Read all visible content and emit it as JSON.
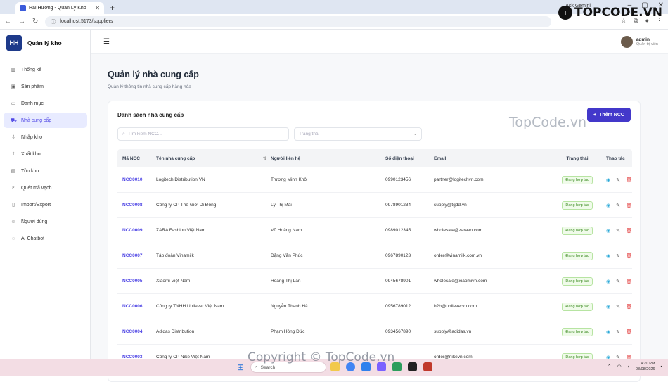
{
  "browser": {
    "tab_title": "Hải Hương - Quản Lý Kho",
    "url": "localhost:5173/suppliers",
    "ask_gemini": "Ask Gemini"
  },
  "sidebar": {
    "brand_name": "Quản lý kho",
    "logo_text": "HH",
    "items": [
      {
        "label": "Thống kê",
        "icon": "chart-icon",
        "active": false
      },
      {
        "label": "Sản phẩm",
        "icon": "box-icon",
        "active": false
      },
      {
        "label": "Danh mục",
        "icon": "folder-icon",
        "active": false
      },
      {
        "label": "Nhà cung cấp",
        "icon": "truck-icon",
        "active": true
      },
      {
        "label": "Nhập kho",
        "icon": "import-icon",
        "active": false
      },
      {
        "label": "Xuất kho",
        "icon": "export-icon",
        "active": false
      },
      {
        "label": "Tồn kho",
        "icon": "inventory-icon",
        "active": false
      },
      {
        "label": "Quét mã vạch",
        "icon": "scan-icon",
        "active": false
      },
      {
        "label": "Import/Export",
        "icon": "file-icon",
        "active": false
      },
      {
        "label": "Người dùng",
        "icon": "user-icon",
        "active": false
      },
      {
        "label": "AI Chatbot",
        "icon": "chat-icon",
        "active": false
      }
    ]
  },
  "topbar": {
    "user_name": "admin",
    "user_role": "Quản trị viên"
  },
  "page": {
    "title": "Quản lý nhà cung cấp",
    "subtitle": "Quản lý thông tin nhà cung cấp hàng hóa"
  },
  "card": {
    "title": "Danh sách nhà cung cấp",
    "add_button": "Thêm NCC",
    "search_placeholder": "Tìm kiếm NCC...",
    "status_placeholder": "Trạng thái"
  },
  "table": {
    "headers": [
      "Mã NCC",
      "Tên nhà cung cấp",
      "Người liên hệ",
      "Số điện thoại",
      "Email",
      "Trạng thái",
      "Thao tác"
    ],
    "rows": [
      {
        "code": "NCC0010",
        "name": "Logitech Distribution VN",
        "contact": "Trương Minh Khôi",
        "phone": "0990123456",
        "email": "partner@logitechvn.com",
        "status": "Đang hợp tác"
      },
      {
        "code": "NCC0008",
        "name": "Công ty CP Thế Giới Di Động",
        "contact": "Lý Thị Mai",
        "phone": "0978901234",
        "email": "supply@tgdd.vn",
        "status": "Đang hợp tác"
      },
      {
        "code": "NCC0009",
        "name": "ZARA Fashion Việt Nam",
        "contact": "Vũ Hoàng Nam",
        "phone": "0989012345",
        "email": "wholesale@zaravn.com",
        "status": "Đang hợp tác"
      },
      {
        "code": "NCC0007",
        "name": "Tập đoàn Vinamilk",
        "contact": "Đặng Văn Phúc",
        "phone": "0967890123",
        "email": "order@vinamilk.com.vn",
        "status": "Đang hợp tác"
      },
      {
        "code": "NCC0005",
        "name": "Xiaomi Việt Nam",
        "contact": "Hoàng Thị Lan",
        "phone": "0945678901",
        "email": "wholesale@xiaomivn.com",
        "status": "Đang hợp tác"
      },
      {
        "code": "NCC0006",
        "name": "Công ty TNHH Unilever Việt Nam",
        "contact": "Nguyễn Thanh Hà",
        "phone": "0956789012",
        "email": "b2b@unilevervn.com",
        "status": "Đang hợp tác"
      },
      {
        "code": "NCC0004",
        "name": "Adidas Distribution",
        "contact": "Phạm Hồng Đức",
        "phone": "0934567890",
        "email": "supply@adidas.vn",
        "status": "Đang hợp tác"
      },
      {
        "code": "NCC0003",
        "name": "Công ty CP Nike Việt Nam",
        "contact": "",
        "phone": "",
        "email": "order@nikevn.com",
        "status": "Đang hợp tác"
      }
    ]
  },
  "taskbar": {
    "search_label": "Search",
    "time": "4:20 PM",
    "date": "08/08/2026"
  },
  "watermarks": {
    "topcode": "TopCode.vn",
    "copyright": "Copyright © TopCode.vn",
    "logo": "TOPCODE.VN"
  },
  "colors": {
    "accent": "#4f46e5",
    "button": "#4338ca",
    "status_green": "#3a8a1f"
  }
}
